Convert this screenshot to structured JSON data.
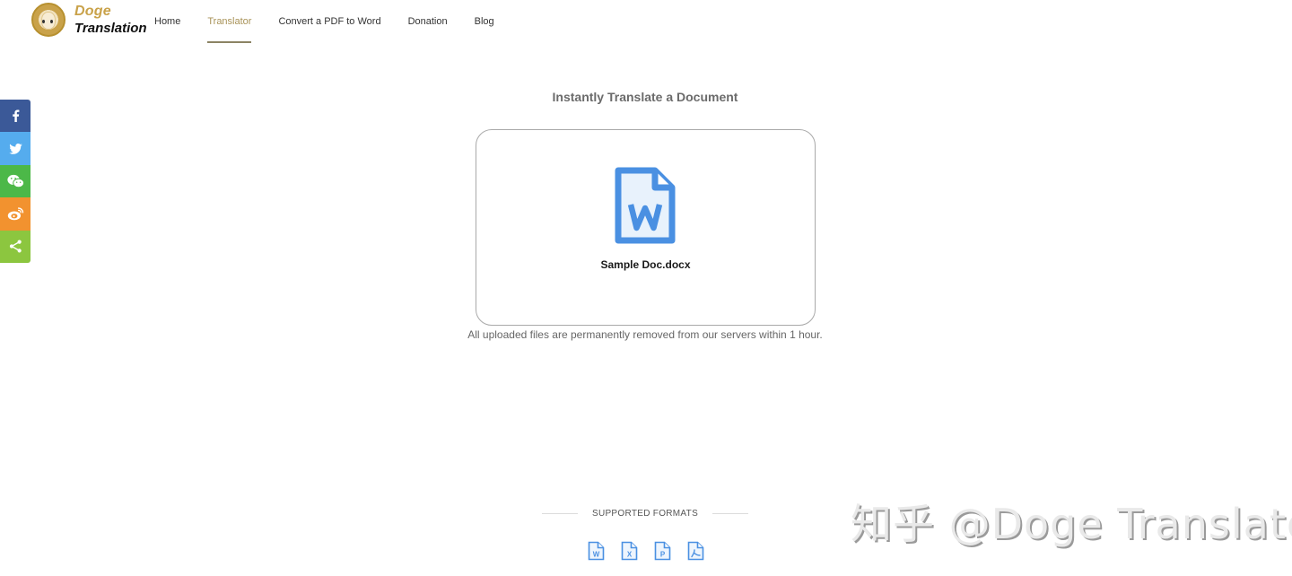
{
  "header": {
    "logo": {
      "line1": "Doge",
      "line2": "Translation"
    },
    "nav": [
      {
        "label": "Home",
        "active": false
      },
      {
        "label": "Translator",
        "active": true
      },
      {
        "label": "Convert a PDF to Word",
        "active": false
      },
      {
        "label": "Donation",
        "active": false
      },
      {
        "label": "Blog",
        "active": false
      }
    ]
  },
  "share": [
    {
      "name": "facebook",
      "icon": "facebook-icon",
      "color": "#3b5998"
    },
    {
      "name": "twitter",
      "icon": "twitter-icon",
      "color": "#55acee"
    },
    {
      "name": "wechat",
      "icon": "wechat-icon",
      "color": "#4cb848"
    },
    {
      "name": "weibo",
      "icon": "weibo-icon",
      "color": "#f2922f"
    },
    {
      "name": "share",
      "icon": "share-icon",
      "color": "#8cc63f"
    }
  ],
  "main": {
    "title": "Instantly Translate a Document",
    "upload": {
      "filename": "Sample Doc.docx",
      "file_icon": "word-document-icon",
      "icon_color": "#4a90e2"
    },
    "notice": "All uploaded files are permanently removed from our servers within 1 hour."
  },
  "formats": {
    "label": "SUPPORTED FORMATS",
    "items": [
      {
        "letter": "W",
        "icon": "word-format-icon"
      },
      {
        "letter": "X",
        "icon": "excel-format-icon"
      },
      {
        "letter": "P",
        "icon": "powerpoint-format-icon"
      },
      {
        "letter": "PDF",
        "icon": "pdf-format-icon"
      }
    ],
    "icon_color": "#4a90e2"
  },
  "watermark": "知乎 @Doge Translator",
  "colors": {
    "accent": "#a89257",
    "underline": "#8c8464"
  }
}
